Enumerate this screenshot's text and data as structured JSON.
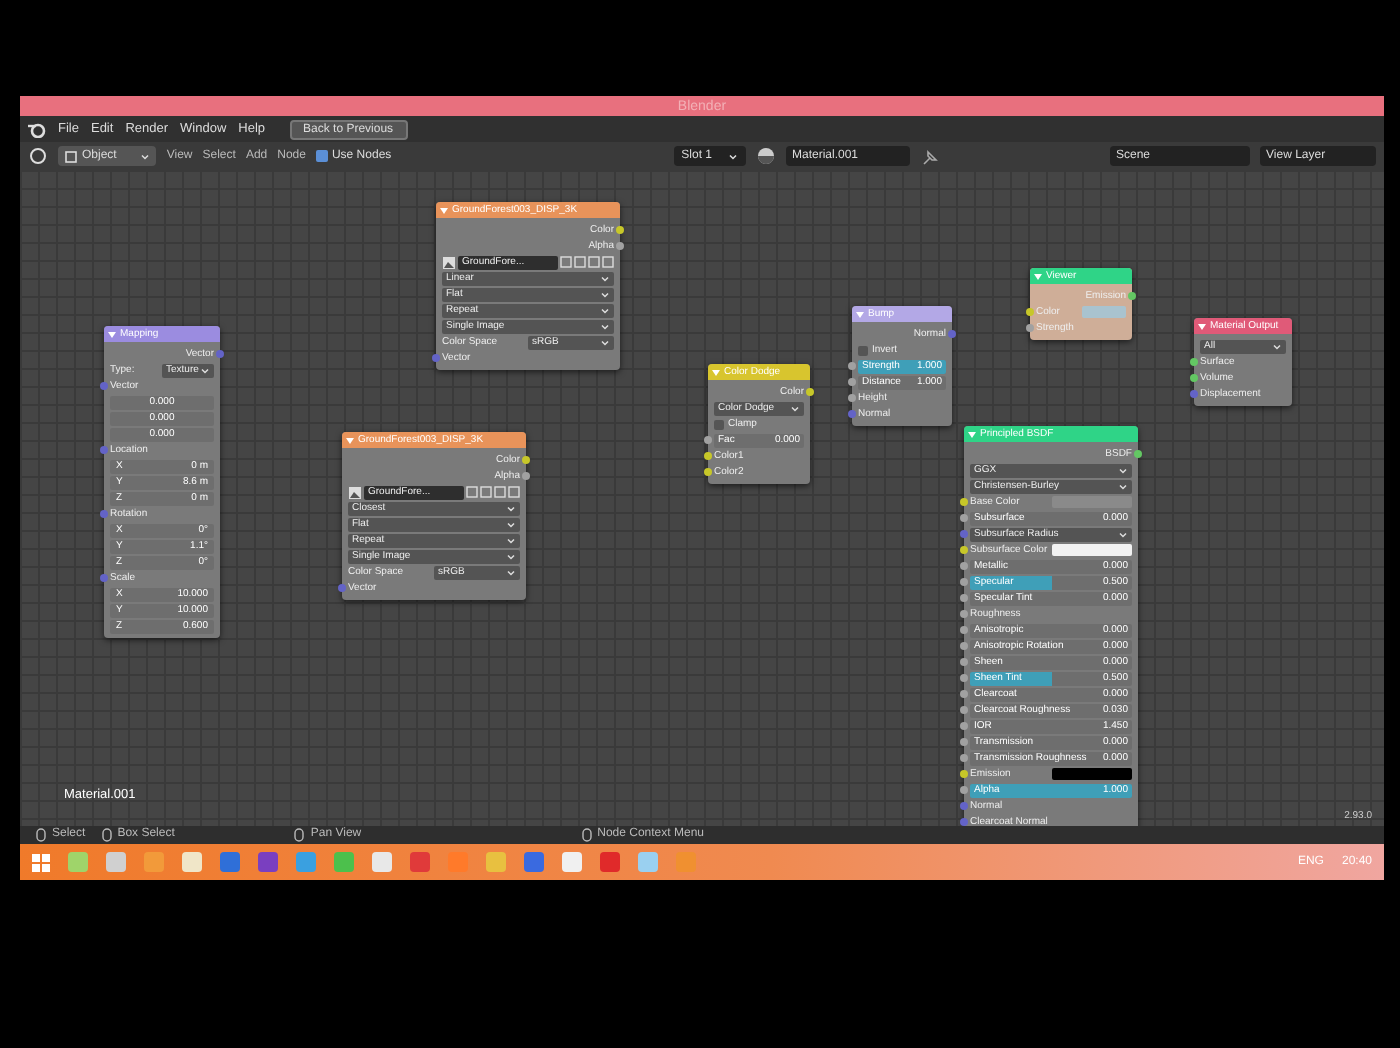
{
  "window": {
    "title": "Blender"
  },
  "menu": [
    "File",
    "Edit",
    "Render",
    "Window",
    "Help"
  ],
  "back_button": "Back to Previous",
  "header": {
    "mode": "Object",
    "menus": [
      "View",
      "Select",
      "Add",
      "Node"
    ],
    "use_nodes": {
      "label": "Use Nodes",
      "checked": true
    },
    "slot": "Slot 1",
    "material": "Material.001",
    "scene": "Scene",
    "view_layer": "View Layer"
  },
  "nodes": [
    {
      "title": "Mapping",
      "color": "#9b8ce0",
      "rows": [
        {
          "kind": "output",
          "label": "Vector",
          "color": "#6363c7"
        },
        {
          "kind": "dropdown",
          "label": "Type:",
          "value": "Texture"
        },
        {
          "kind": "input",
          "label": "Vector",
          "color": "#6363c7"
        },
        {
          "kind": "number",
          "value": "0.000"
        },
        {
          "kind": "number",
          "value": "0.000"
        },
        {
          "kind": "number",
          "value": "0.000"
        },
        {
          "kind": "input",
          "label": "Location",
          "color": "#6363c7"
        },
        {
          "kind": "number",
          "axis": "X",
          "value": "0 m"
        },
        {
          "kind": "number",
          "axis": "Y",
          "value": "8.6 m"
        },
        {
          "kind": "number",
          "axis": "Z",
          "value": "0 m"
        },
        {
          "kind": "input",
          "label": "Rotation",
          "color": "#6363c7"
        },
        {
          "kind": "number",
          "axis": "X",
          "value": "0°"
        },
        {
          "kind": "number",
          "axis": "Y",
          "value": "1.1°"
        },
        {
          "kind": "number",
          "axis": "Z",
          "value": "0°"
        },
        {
          "kind": "input",
          "label": "Scale",
          "color": "#6363c7"
        },
        {
          "kind": "number",
          "axis": "X",
          "value": "10.000"
        },
        {
          "kind": "number",
          "axis": "Y",
          "value": "10.000"
        },
        {
          "kind": "number",
          "axis": "Z",
          "value": "0.600"
        }
      ]
    },
    {
      "title": "GroundForest003_DISP_3K",
      "color": "#e8935a",
      "rows": [
        {
          "kind": "output",
          "label": "Color",
          "color": "#c7c729"
        },
        {
          "kind": "output",
          "label": "Alpha",
          "color": "#a1a1a1"
        },
        {
          "kind": "image",
          "value": "GroundFore..."
        },
        {
          "kind": "dropdown",
          "value": "Linear"
        },
        {
          "kind": "dropdown",
          "value": "Flat"
        },
        {
          "kind": "dropdown",
          "value": "Repeat"
        },
        {
          "kind": "dropdown",
          "value": "Single Image"
        },
        {
          "kind": "dropdown",
          "label": "Color Space",
          "value": "sRGB"
        },
        {
          "kind": "input",
          "label": "Vector",
          "color": "#6363c7"
        }
      ]
    },
    {
      "title": "GroundForest003_DISP_3K",
      "color": "#e8935a",
      "rows": [
        {
          "kind": "output",
          "label": "Color",
          "color": "#c7c729"
        },
        {
          "kind": "output",
          "label": "Alpha",
          "color": "#a1a1a1"
        },
        {
          "kind": "image",
          "value": "GroundFore..."
        },
        {
          "kind": "dropdown",
          "value": "Closest"
        },
        {
          "kind": "dropdown",
          "value": "Flat"
        },
        {
          "kind": "dropdown",
          "value": "Repeat"
        },
        {
          "kind": "dropdown",
          "value": "Single Image"
        },
        {
          "kind": "dropdown",
          "label": "Color Space",
          "value": "sRGB"
        },
        {
          "kind": "input",
          "label": "Vector",
          "color": "#6363c7"
        }
      ]
    },
    {
      "title": "Color Dodge",
      "color": "#d8c52e",
      "rows": [
        {
          "kind": "output",
          "label": "Color",
          "color": "#c7c729"
        },
        {
          "kind": "dropdown",
          "value": "Color Dodge"
        },
        {
          "kind": "checkbox",
          "label": "Clamp",
          "checked": false
        },
        {
          "kind": "slider",
          "label": "Fac",
          "value": "0.000",
          "level": 0,
          "color": "#a1a1a1"
        },
        {
          "kind": "input",
          "label": "Color1",
          "color": "#c7c729"
        },
        {
          "kind": "input",
          "label": "Color2",
          "color": "#c7c729"
        }
      ]
    },
    {
      "title": "Bump",
      "color": "#b3a8e6",
      "rows": [
        {
          "kind": "output",
          "label": "Normal",
          "color": "#6363c7"
        },
        {
          "kind": "checkbox",
          "label": "Invert",
          "checked": false
        },
        {
          "kind": "slider",
          "label": "Strength",
          "value": "1.000",
          "level": 1,
          "color": "#a1a1a1"
        },
        {
          "kind": "slider",
          "label": "Distance",
          "value": "1.000",
          "level": 0,
          "color": "#a1a1a1"
        },
        {
          "kind": "input",
          "label": "Height",
          "color": "#a1a1a1"
        },
        {
          "kind": "input",
          "label": "Normal",
          "color": "#6363c7"
        }
      ]
    },
    {
      "title": "Viewer",
      "color": "#2fd487",
      "rows": [
        {
          "kind": "output",
          "label": "Emission",
          "color": "#63c763"
        },
        {
          "kind": "color_input",
          "label": "Color",
          "color": "#a9c3cf",
          "socket": {
            "color": "#c7c729"
          }
        },
        {
          "kind": "input",
          "label": "Strength",
          "color": "#a1a1a1"
        }
      ]
    },
    {
      "title": "Material Output",
      "color": "#e05a78",
      "rows": [
        {
          "kind": "dropdown",
          "value": "All"
        },
        {
          "kind": "input",
          "label": "Surface",
          "color": "#63c763"
        },
        {
          "kind": "input",
          "label": "Volume",
          "color": "#63c763"
        },
        {
          "kind": "input",
          "label": "Displacement",
          "color": "#6363c7"
        }
      ]
    },
    {
      "title": "Principled BSDF",
      "color": "#2fd487",
      "rows": [
        {
          "kind": "output",
          "label": "BSDF",
          "color": "#63c763"
        },
        {
          "kind": "dropdown",
          "value": "GGX"
        },
        {
          "kind": "dropdown",
          "value": "Christensen-Burley"
        },
        {
          "kind": "color_input",
          "label": "Base Color",
          "color": "#8a8a8a",
          "socket": {
            "color": "#c7c729"
          }
        },
        {
          "kind": "slider",
          "label": "Subsurface",
          "value": "0.000",
          "level": 0,
          "color": "#a1a1a1"
        },
        {
          "kind": "dropdown",
          "value": "Subsurface Radius",
          "color": "#6363c7"
        },
        {
          "kind": "color_input",
          "label": "Subsurface Color",
          "color": "#f2f2f2",
          "socket": {
            "color": "#c7c729"
          }
        },
        {
          "kind": "slider",
          "label": "Metallic",
          "value": "0.000",
          "level": 0,
          "color": "#a1a1a1"
        },
        {
          "kind": "slider",
          "label": "Specular",
          "value": "0.500",
          "level": 0.5,
          "color": "#a1a1a1"
        },
        {
          "kind": "slider",
          "label": "Specular Tint",
          "value": "0.000",
          "level": 0,
          "color": "#a1a1a1"
        },
        {
          "kind": "input",
          "label": "Roughness",
          "color": "#a1a1a1"
        },
        {
          "kind": "slider",
          "label": "Anisotropic",
          "value": "0.000",
          "level": 0,
          "color": "#a1a1a1"
        },
        {
          "kind": "slider",
          "label": "Anisotropic Rotation",
          "value": "0.000",
          "level": 0,
          "color": "#a1a1a1"
        },
        {
          "kind": "slider",
          "label": "Sheen",
          "value": "0.000",
          "level": 0,
          "color": "#a1a1a1"
        },
        {
          "kind": "slider",
          "label": "Sheen Tint",
          "value": "0.500",
          "level": 0.5,
          "color": "#a1a1a1"
        },
        {
          "kind": "slider",
          "label": "Clearcoat",
          "value": "0.000",
          "level": 0,
          "color": "#a1a1a1"
        },
        {
          "kind": "slider",
          "label": "Clearcoat Roughness",
          "value": "0.030",
          "level": 0,
          "color": "#a1a1a1"
        },
        {
          "kind": "slider",
          "label": "IOR",
          "value": "1.450",
          "level": 0,
          "color": "#a1a1a1"
        },
        {
          "kind": "slider",
          "label": "Transmission",
          "value": "0.000",
          "level": 0,
          "color": "#a1a1a1"
        },
        {
          "kind": "slider",
          "label": "Transmission Roughness",
          "value": "0.000",
          "level": 0,
          "color": "#a1a1a1"
        },
        {
          "kind": "color_input",
          "label": "Emission",
          "color": "#000000",
          "socket": {
            "color": "#c7c729"
          }
        },
        {
          "kind": "slider",
          "label": "Alpha",
          "value": "1.000",
          "level": 1,
          "color": "#a1a1a1"
        },
        {
          "kind": "input",
          "label": "Normal",
          "color": "#6363c7"
        },
        {
          "kind": "input",
          "label": "Clearcoat Normal",
          "color": "#6363c7"
        }
      ]
    }
  ],
  "canvas_label": "Material.001",
  "version": "2.93.0",
  "status_bar": [
    "Select",
    "Box Select",
    "Pan View",
    "Node Context Menu"
  ],
  "taskbar": {
    "apps": [
      {
        "color": "#9fd46a"
      },
      {
        "color": "#d0d0d0"
      },
      {
        "color": "#f29a3a"
      },
      {
        "color": "#f0e6c8"
      },
      {
        "color": "#2f6fd8"
      },
      {
        "color": "#7a3fc0"
      },
      {
        "color": "#3aa0e0"
      },
      {
        "color": "#4cc04c"
      },
      {
        "color": "#e8e8e8"
      },
      {
        "color": "#e03a3a"
      },
      {
        "color": "#ff7a2a"
      },
      {
        "color": "#e8c040"
      },
      {
        "color": "#3a6ae0"
      },
      {
        "color": "#f0f0f0"
      },
      {
        "color": "#e02a2a"
      },
      {
        "color": "#9ad0f0"
      },
      {
        "color": "#f09030"
      }
    ],
    "language": "ENG",
    "clock": "20:40"
  }
}
